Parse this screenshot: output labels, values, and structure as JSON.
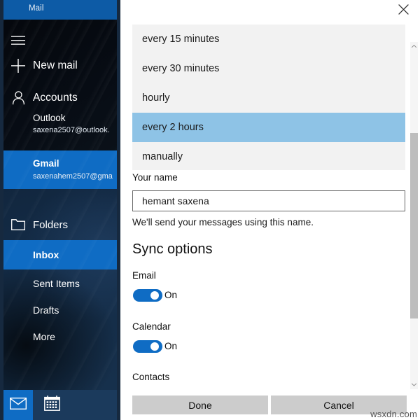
{
  "window": {
    "title": "Mail",
    "close_icon": "close-icon"
  },
  "sidebar": {
    "hamburger_icon": "hamburger-menu-icon",
    "new_mail": {
      "label": "New mail",
      "icon": "plus-icon"
    },
    "accounts": {
      "label": "Accounts",
      "icon": "person-icon"
    },
    "account_list": [
      {
        "name": "Outlook",
        "email": "saxena2507@outlook.",
        "selected": false
      },
      {
        "name": "Gmail",
        "email": "saxenahem2507@gma",
        "selected": true
      }
    ],
    "folders": {
      "label": "Folders",
      "icon": "folder-icon"
    },
    "folder_items": [
      {
        "label": "Inbox",
        "selected": true
      },
      {
        "label": "Sent Items",
        "selected": false
      },
      {
        "label": "Drafts",
        "selected": false
      },
      {
        "label": "More",
        "selected": false
      }
    ],
    "bottom_bar": [
      {
        "icon": "mail-icon",
        "active": true
      },
      {
        "icon": "calendar-icon",
        "active": false
      }
    ]
  },
  "settings": {
    "sync_frequency_options": [
      {
        "label": "every 15 minutes",
        "selected": false
      },
      {
        "label": "every 30 minutes",
        "selected": false
      },
      {
        "label": "hourly",
        "selected": false
      },
      {
        "label": "every 2 hours",
        "selected": true
      },
      {
        "label": "manually",
        "selected": false
      }
    ],
    "your_name_label": "Your name",
    "your_name_value": "hemant saxena",
    "your_name_placeholder": "Your name",
    "your_name_hint": "We'll send your messages using this name.",
    "sync_options_heading": "Sync options",
    "sync_toggles": [
      {
        "label": "Email",
        "state": "On"
      },
      {
        "label": "Calendar",
        "state": "On"
      }
    ],
    "contacts_label": "Contacts",
    "done_label": "Done",
    "cancel_label": "Cancel",
    "scroll_up_arrow": "chevron-up-icon",
    "scroll_down_arrow": "chevron-down-icon"
  },
  "watermark": "wsxdn.com",
  "colors": {
    "accent_blue": "#0f6cc4",
    "title_blue": "#0d5ba6",
    "selection_light_blue": "#8ec3e6",
    "dropdown_bg": "#f2f2f2",
    "button_gray": "#cccccc"
  }
}
